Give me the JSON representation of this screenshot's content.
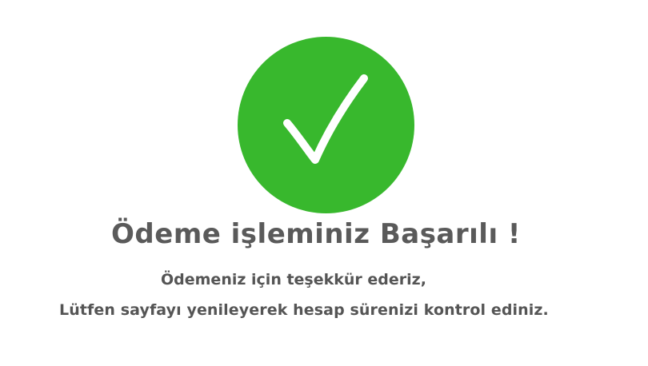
{
  "status_icon": "check-icon",
  "colors": {
    "success_green": "#38b82d",
    "text_gray": "#5a5a5a"
  },
  "message": {
    "title": "Ödeme işleminiz Başarılı !",
    "thanks": "Ödemeniz için teşekkür ederiz,",
    "info": "Lütfen sayfayı yenileyerek hesap sürenizi kontrol ediniz."
  }
}
